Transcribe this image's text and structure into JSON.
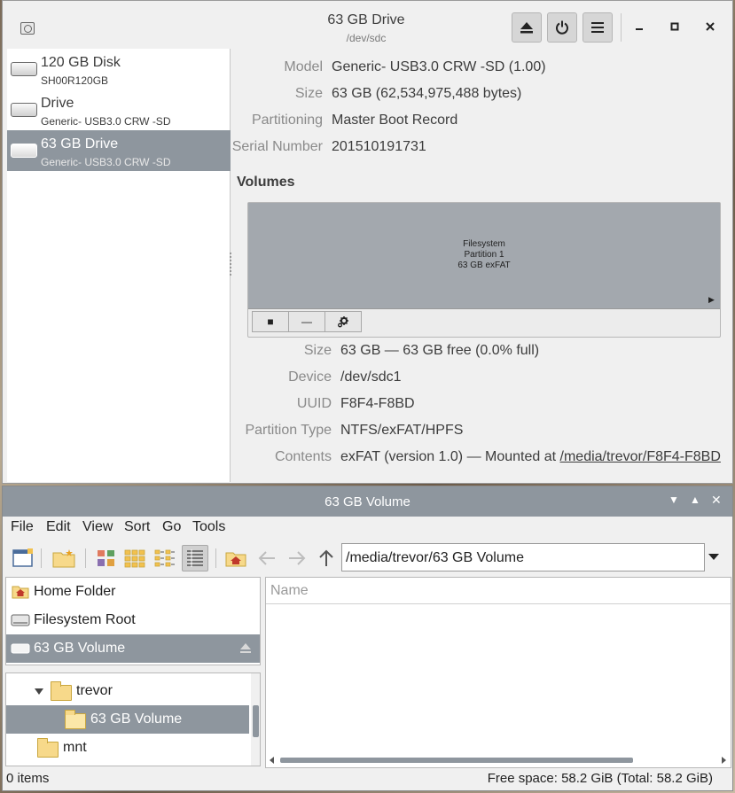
{
  "disks_window": {
    "title": "63 GB Drive",
    "subtitle": "/dev/sdc",
    "header_buttons": {
      "eject": "eject-icon",
      "power": "power-icon",
      "menu": "hamburger-menu-icon"
    },
    "drives": [
      {
        "name": "120 GB Disk",
        "model": "SH00R120GB"
      },
      {
        "name": "Drive",
        "model": "Generic- USB3.0 CRW   -SD"
      },
      {
        "name": "63 GB Drive",
        "model": "Generic- USB3.0 CRW   -SD",
        "selected": true
      }
    ],
    "drive_info": {
      "model_label": "Model",
      "model_value": "Generic- USB3.0 CRW   -SD (1.00)",
      "size_label": "Size",
      "size_value": "63 GB (62,534,975,488 bytes)",
      "partitioning_label": "Partitioning",
      "partitioning_value": "Master Boot Record",
      "serial_label": "Serial Number",
      "serial_value": "201510191731"
    },
    "volumes_heading": "Volumes",
    "volume_block": {
      "line1": "Filesystem",
      "line2": "Partition 1",
      "line3": "63 GB exFAT"
    },
    "volume_tools": {
      "stop": "stop-icon",
      "remove": "minus-icon",
      "settings": "gears-icon"
    },
    "volume_info": {
      "size_label": "Size",
      "size_value": "63 GB — 63 GB free (0.0% full)",
      "device_label": "Device",
      "device_value": "/dev/sdc1",
      "uuid_label": "UUID",
      "uuid_value": "F8F4-F8BD",
      "ptype_label": "Partition Type",
      "ptype_value": "NTFS/exFAT/HPFS",
      "contents_label": "Contents",
      "contents_prefix": "exFAT (version 1.0) — Mounted at ",
      "contents_link": "/media/trevor/F8F4-F8BD"
    }
  },
  "file_manager": {
    "title": "63 GB Volume",
    "menus": [
      "File",
      "Edit",
      "View",
      "Sort",
      "Go",
      "Tools"
    ],
    "path": "/media/trevor/63 GB Volume",
    "places": [
      {
        "label": "Home Folder"
      },
      {
        "label": "Filesystem Root"
      },
      {
        "label": "63 GB Volume",
        "selected": true
      }
    ],
    "tree": [
      {
        "label": "trevor"
      },
      {
        "label": "63 GB Volume",
        "selected": true
      },
      {
        "label": "mnt"
      }
    ],
    "column_name": "Name",
    "status_items": "0 items",
    "status_space": "Free space: 58.2 GiB (Total: 58.2 GiB)"
  },
  "colors": {
    "selection": "#8e969e",
    "window_bg": "#f0f0f0",
    "folder": "#f7d98a"
  }
}
